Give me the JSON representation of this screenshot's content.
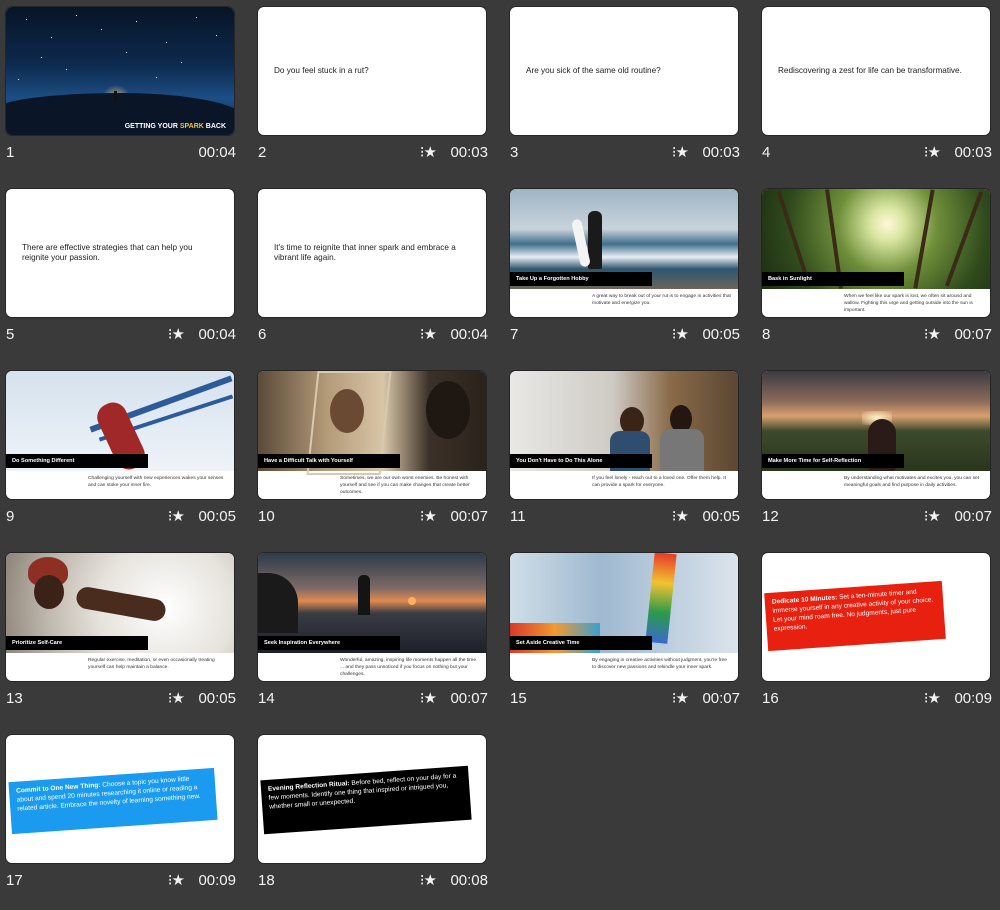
{
  "slides": [
    {
      "number": "1",
      "duration": "00:04",
      "title_a": "GETTING YOUR ",
      "title_b": "SPARK",
      "title_c": " BACK"
    },
    {
      "number": "2",
      "duration": "00:03",
      "text": "Do you feel stuck in a rut?"
    },
    {
      "number": "3",
      "duration": "00:03",
      "text": "Are you sick of the same old routine?"
    },
    {
      "number": "4",
      "duration": "00:03",
      "text": "Rediscovering a zest for life can be transformative."
    },
    {
      "number": "5",
      "duration": "00:04",
      "text": "There are effective strategies that can help you reignite your passion."
    },
    {
      "number": "6",
      "duration": "00:04",
      "text": "It's time to reignite that inner spark and embrace a vibrant life again."
    },
    {
      "number": "7",
      "duration": "00:05",
      "label": "Take Up a Forgotten Hobby",
      "caption": "A great way to break out of your rut is to engage in activities that motivate and energize you."
    },
    {
      "number": "8",
      "duration": "00:07",
      "label": "Bask in Sunlight",
      "caption": "When we feel like our spark is lost, we often sit around and wallow. Fighting this urge and getting outside into the sun is important."
    },
    {
      "number": "9",
      "duration": "00:05",
      "label": "Do Something Different",
      "caption": "Challenging yourself with new experiences wakes your senses and can stoke your inner fire."
    },
    {
      "number": "10",
      "duration": "00:07",
      "label": "Have a Difficult Talk with Yourself",
      "caption": "Sometimes, we are our own worst enemies. Be honest with yourself and see if you can make changes that create better outcomes."
    },
    {
      "number": "11",
      "duration": "00:05",
      "label": "You Don't Have to Do This Alone",
      "caption": "If you feel lonely - reach out to a loved one. Offer them help. It can provide a spark for everyone."
    },
    {
      "number": "12",
      "duration": "00:07",
      "label": "Make More Time for Self-Reflection",
      "caption": "By understanding what motivates and excites you, you can set meaningful goals and find purpose in daily activities."
    },
    {
      "number": "13",
      "duration": "00:05",
      "label": "Prioritize Self-Care",
      "caption": "Regular exercise, meditation, or even occasionally treating yourself can help maintain a balance."
    },
    {
      "number": "14",
      "duration": "00:07",
      "label": "Seek Inspiration Everywhere",
      "caption": "Wonderful, amazing, inspiring life moments happen all the time ... and they pass unnoticed if you focus on nothing but your challenges."
    },
    {
      "number": "15",
      "duration": "00:07",
      "label": "Set Aside Creative Time",
      "caption": "By engaging in creative activities without judgment, you're free to discover new passions and rekindle your inner spark."
    },
    {
      "number": "16",
      "duration": "00:09",
      "card_bold": "Dedicate 10 Minutes:",
      "card_text": " Set a ten-minute timer and immerse yourself in any creative activity of your choice. Let your mind roam free. No judgments, just pure expression."
    },
    {
      "number": "17",
      "duration": "00:09",
      "card_bold": "Commit to One New Thing:",
      "card_text": " Choose a topic you know little about and spend 20 minutes researching it online or reading a related article. Embrace the novelty of learning something new."
    },
    {
      "number": "18",
      "duration": "00:08",
      "card_bold": "Evening Reflection Ritual:",
      "card_text": " Before bed, reflect on your day for a few moments. Identify one thing that inspired or intrigued you, whether small or unexpected."
    }
  ],
  "icons": {
    "transition": "transition-effect-icon",
    "glyph": "⁝★"
  },
  "colors": {
    "background": "#3a3a3a",
    "card16": "#e8200f",
    "card17": "#1a9bf0",
    "card18": "#000000",
    "spark": "#f2c230"
  }
}
